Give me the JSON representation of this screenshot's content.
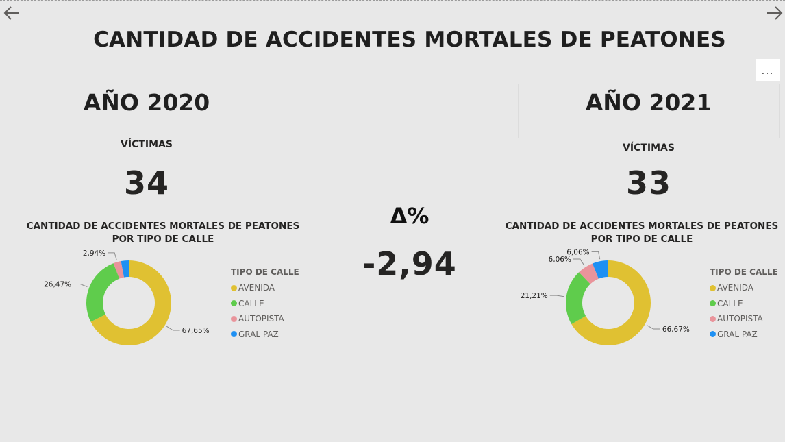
{
  "title": "CANTIDAD DE ACCIDENTES MORTALES DE PEATONES",
  "delta": {
    "label": "Δ%",
    "value": "-2,94"
  },
  "colors": {
    "avenida": "#e0c132",
    "calle": "#5fcc4c",
    "autopista": "#e9949b",
    "gral_paz": "#1e90f3"
  },
  "icons": {
    "back": "arrow-left-icon",
    "forward": "arrow-right-icon",
    "more": "more-options-icon"
  },
  "more_label": "...",
  "panels": [
    {
      "year": "AÑO 2020",
      "victims_label": "VÍCTIMAS",
      "victims_value": "34",
      "chart_title": "CANTIDAD DE ACCIDENTES MORTALES DE PEATONES POR TIPO DE CALLE",
      "legend_title": "TIPO DE CALLE",
      "legend": [
        "AVENIDA",
        "CALLE",
        "AUTOPISTA",
        "GRAL PAZ"
      ]
    },
    {
      "year": "AÑO 2021",
      "victims_label": "VÍCTIMAS",
      "victims_value": "33",
      "chart_title": "CANTIDAD DE ACCIDENTES MORTALES DE PEATONES POR TIPO DE CALLE",
      "legend_title": "TIPO DE CALLE",
      "legend": [
        "AVENIDA",
        "CALLE",
        "AUTOPISTA",
        "GRAL PAZ"
      ]
    }
  ],
  "chart_data": [
    {
      "type": "pie",
      "donut": true,
      "title": "CANTIDAD DE ACCIDENTES MORTALES DE PEATONES POR TIPO DE CALLE",
      "legend_title": "TIPO DE CALLE",
      "categories": [
        "AVENIDA",
        "CALLE",
        "AUTOPISTA",
        "GRAL PAZ"
      ],
      "values": [
        67.65,
        26.47,
        2.94,
        2.94
      ],
      "data_labels": [
        "67,65%",
        "26,47%",
        "2,94%",
        ""
      ],
      "legend_position": "right"
    },
    {
      "type": "pie",
      "donut": true,
      "title": "CANTIDAD DE ACCIDENTES MORTALES DE PEATONES POR TIPO DE CALLE",
      "legend_title": "TIPO DE CALLE",
      "categories": [
        "AVENIDA",
        "CALLE",
        "AUTOPISTA",
        "GRAL PAZ"
      ],
      "values": [
        66.67,
        21.21,
        6.06,
        6.06
      ],
      "data_labels": [
        "66,67%",
        "21,21%",
        "6,06%",
        "6,06%"
      ],
      "legend_position": "right"
    }
  ]
}
